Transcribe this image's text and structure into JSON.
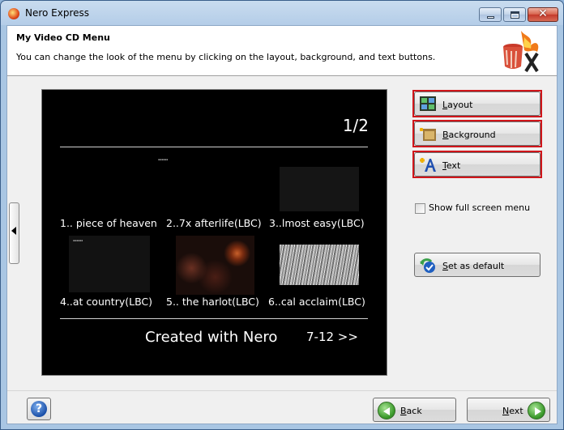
{
  "window": {
    "title": "Nero Express"
  },
  "header": {
    "title": "My Video CD Menu",
    "description": "You can change the look of the menu by clicking on the layout, background, and text buttons."
  },
  "preview": {
    "page_number": "1/2",
    "titles": [
      "1.. piece of heaven",
      "2..7x afterlife(LBC)",
      "3..lmost easy(LBC)",
      "4..at country(LBC)",
      "5.. the harlot(LBC)",
      "6..cal acclaim(LBC)"
    ],
    "footer_text": "Created with Nero",
    "next_page_link": "7-12 >>"
  },
  "buttons": {
    "layout": {
      "label": "Layout",
      "mnemonic": "L",
      "rest": "ayout"
    },
    "background": {
      "label": "Background",
      "mnemonic": "B",
      "rest": "ackground"
    },
    "text": {
      "label": "Text",
      "mnemonic": "T",
      "rest": "ext"
    },
    "set_default": {
      "label": "Set as default",
      "mnemonic": "S",
      "rest": "et as default"
    },
    "back": {
      "label": "Back",
      "mnemonic": "B",
      "rest": "ack"
    },
    "next": {
      "label": "Next",
      "mnemonic": "N",
      "rest": "ext"
    }
  },
  "options": {
    "show_full_screen_menu": {
      "label": "Show full screen menu",
      "checked": false
    }
  },
  "colors": {
    "highlight_border": "#d0151a",
    "preview_background": "#000000",
    "nav_arrow_green": "#3c9b2c"
  },
  "icons": [
    "nero-logo-icon",
    "layout-grid-icon",
    "background-icon",
    "text-a-icon",
    "set-default-icon",
    "help-icon",
    "back-arrow-icon",
    "next-arrow-icon",
    "collapse-arrow-icon"
  ]
}
